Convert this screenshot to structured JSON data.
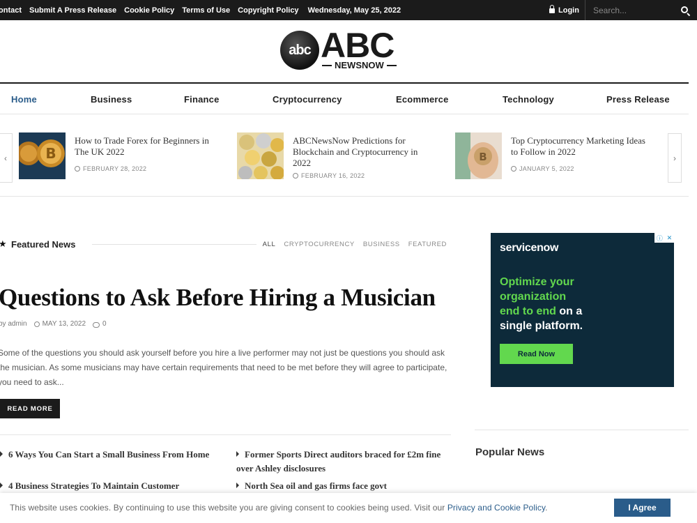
{
  "topbar": {
    "links": [
      "ontact",
      "Submit A Press Release",
      "Cookie Policy",
      "Terms of Use",
      "Copyright Policy"
    ],
    "date": "Wednesday, May 25, 2022",
    "login": "Login",
    "search_placeholder": "Search..."
  },
  "logo": {
    "circle_text": "abc",
    "main": "ABC",
    "sub": "NEWSNOW"
  },
  "nav": [
    "Home",
    "Business",
    "Finance",
    "Cryptocurrency",
    "Ecommerce",
    "Technology",
    "Press Release"
  ],
  "carousel": {
    "prev": "‹",
    "next": "›",
    "items": [
      {
        "title": "How to Trade Forex for Beginners in The UK 2022",
        "date": "FEBRUARY 28, 2022"
      },
      {
        "title": "ABCNewsNow Predictions for Blockchain and Cryptocurrency in 2022",
        "date": "FEBRUARY 16, 2022"
      },
      {
        "title": "Top Cryptocurrency Marketing Ideas to Follow in 2022",
        "date": "JANUARY 5, 2022"
      }
    ]
  },
  "featured": {
    "label": "Featured News",
    "filters": [
      "ALL",
      "CRYPTOCURRENCY",
      "BUSINESS",
      "FEATURED"
    ],
    "headline": "Questions to Ask Before Hiring a Musician",
    "author": "by admin",
    "date": "MAY 13, 2022",
    "comments": "0",
    "excerpt": "Some of the questions you should ask yourself before you hire a live performer may not just be questions you should ask the musician. As some musicians may have certain requirements that need to be met before they will agree to participate, you need to ask...",
    "read_more": "READ MORE"
  },
  "related": [
    "6 Ways You Can Start a Small Business From Home",
    "Former Sports Direct auditors braced for £2m fine over Ashley disclosures",
    "4 Business Strategies To Maintain Customer",
    "North Sea oil and gas firms face govt"
  ],
  "ad": {
    "brand": "servicenow",
    "line1": "Optimize your",
    "line2": "organization",
    "line3a": "end to end",
    "line3b": " on a",
    "line4": "single platform.",
    "button": "Read Now"
  },
  "sidebar": {
    "popular_title": "Popular News"
  },
  "cookie": {
    "text": "This website uses cookies. By continuing to use this website you are giving consent to cookies being used. Visit our ",
    "link": "Privacy and Cookie Policy",
    "end": ".",
    "button": "I Agree"
  }
}
